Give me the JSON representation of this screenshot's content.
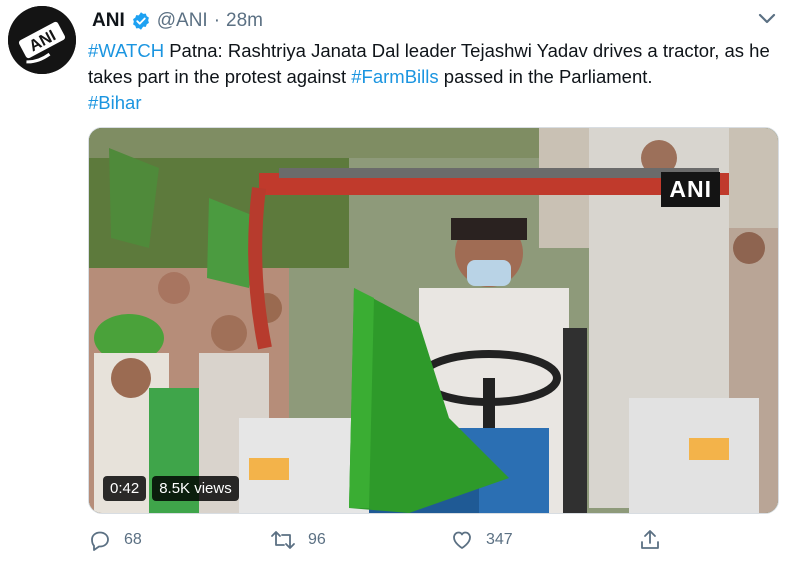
{
  "author": {
    "display_name": "ANI",
    "handle": "@ANI",
    "separator": "·",
    "time": "28m",
    "avatar_text": "ANI"
  },
  "tweet": {
    "part1_tag": "#WATCH",
    "part2": " Patna: Rashtriya Janata Dal leader Tejashwi Yadav drives a tractor, as he takes part in the protest against ",
    "part3_tag": "#FarmBills",
    "part4": " passed in the Parliament.",
    "part5_tag": "#Bihar"
  },
  "media": {
    "watermark": "ANI",
    "duration": "0:42",
    "views": "8.5K views"
  },
  "actions": {
    "reply_count": "68",
    "retweet_count": "96",
    "like_count": "347"
  },
  "colors": {
    "link": "#1b95e0",
    "muted": "#5b7083",
    "flag_green": "#2e9a2a"
  },
  "icons": [
    "verified-badge-icon",
    "chevron-down-icon",
    "reply-icon",
    "retweet-icon",
    "like-icon",
    "share-icon"
  ]
}
